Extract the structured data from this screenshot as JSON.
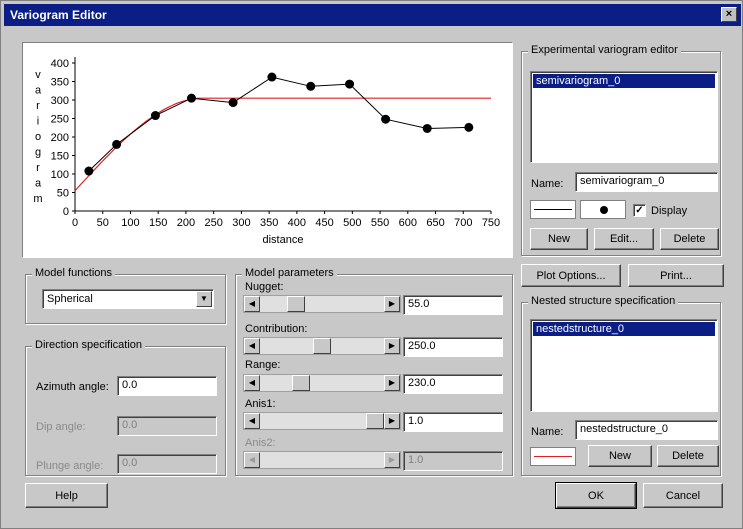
{
  "window": {
    "title": "Variogram Editor",
    "close_glyph": "×"
  },
  "chart_data": {
    "type": "line",
    "xlabel": "distance",
    "ylabel_letters": [
      "v",
      "a",
      "r",
      "i",
      "o",
      "g",
      "r",
      "a",
      "m"
    ],
    "xlim": [
      0,
      750
    ],
    "ylim": [
      0,
      400
    ],
    "x_ticks": [
      0,
      50,
      100,
      150,
      200,
      250,
      300,
      350,
      400,
      450,
      500,
      550,
      600,
      650,
      700,
      750
    ],
    "y_ticks": [
      0,
      50,
      100,
      150,
      200,
      250,
      300,
      350,
      400
    ],
    "experimental": {
      "x": [
        25,
        75,
        145,
        210,
        285,
        355,
        425,
        495,
        560,
        635,
        710
      ],
      "y": [
        108,
        180,
        258,
        305,
        293,
        362,
        337,
        343,
        248,
        223,
        226
      ]
    },
    "model": {
      "nugget": 55.0,
      "contribution": 250.0,
      "range": 230.0,
      "x_max": 750
    },
    "colors": {
      "experimental": "#000000",
      "model": "#e02020"
    }
  },
  "experimental_editor": {
    "group_label": "Experimental variogram editor",
    "items": [
      "semivariogram_0"
    ],
    "name_label": "Name:",
    "name_value": "semivariogram_0",
    "display_label": "Display",
    "display_checked": "✓",
    "buttons": {
      "new": "New",
      "edit": "Edit...",
      "delete": "Delete"
    }
  },
  "plot_options_label": "Plot Options...",
  "print_label": "Print...",
  "model_functions": {
    "group_label": "Model functions",
    "selected": "Spherical"
  },
  "direction": {
    "group_label": "Direction specification",
    "azimuth_label": "Azimuth angle:",
    "azimuth_value": "0.0",
    "dip_label": "Dip angle:",
    "dip_value": "0.0",
    "plunge_label": "Plunge angle:",
    "plunge_value": "0.0"
  },
  "model_parameters": {
    "group_label": "Model parameters",
    "nugget_label": "Nugget:",
    "nugget_value": "55.0",
    "nugget_level": 0.25,
    "contribution_label": "Contribution:",
    "contribution_value": "250.0",
    "contribution_level": 0.5,
    "range_label": "Range:",
    "range_value": "230.0",
    "range_level": 0.3,
    "anis1_label": "Anis1:",
    "anis1_value": "1.0",
    "anis1_level": 1.0,
    "anis2_label": "Anis2:",
    "anis2_value": "1.0"
  },
  "nested": {
    "group_label": "Nested structure specification",
    "items": [
      "nestedstructure_0"
    ],
    "name_label": "Name:",
    "name_value": "nestedstructure_0",
    "buttons": {
      "new": "New",
      "delete": "Delete"
    }
  },
  "footer": {
    "help": "Help",
    "ok": "OK",
    "cancel": "Cancel"
  }
}
